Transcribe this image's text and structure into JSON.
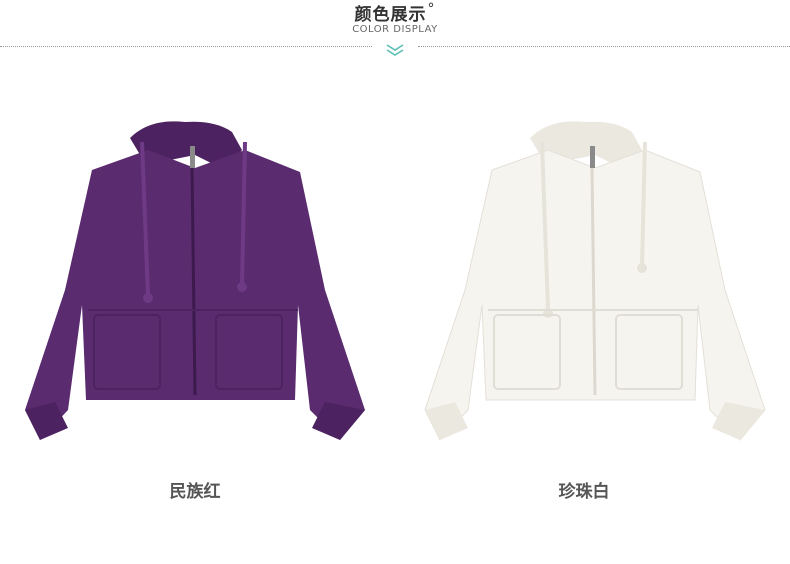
{
  "header": {
    "title": "颜色展示",
    "title_mark": "°",
    "subtitle": "COLOR DISPLAY",
    "chevron_icon": "double-chevron-down-icon",
    "accent_color": "#5dbfb4"
  },
  "products": [
    {
      "name": "民族红",
      "color": "#5a2b6e"
    },
    {
      "name": "珍珠白",
      "color": "#f4f2ec"
    }
  ]
}
